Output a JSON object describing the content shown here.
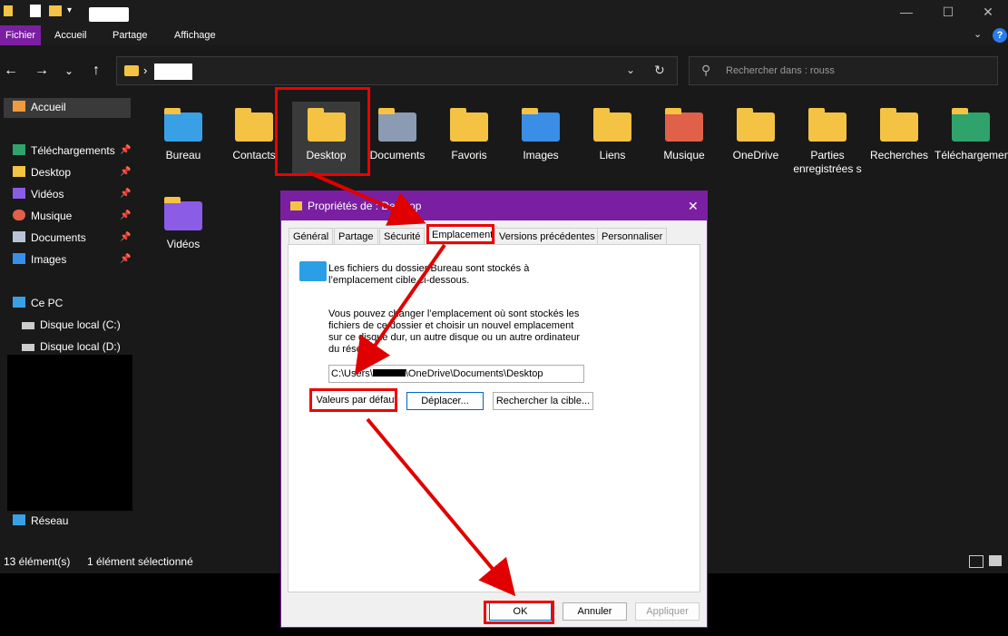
{
  "ribbon": {
    "tabs": [
      "Fichier",
      "Accueil",
      "Partage",
      "Affichage"
    ]
  },
  "search": {
    "placeholder": "Rechercher dans : rouss"
  },
  "sidebar": {
    "items": [
      {
        "label": "Accueil",
        "icon": "home-icon"
      },
      {
        "label": "Téléchargements",
        "icon": "download-icon"
      },
      {
        "label": "Desktop",
        "icon": "folder-icon"
      },
      {
        "label": "Vidéos",
        "icon": "video-icon"
      },
      {
        "label": "Musique",
        "icon": "music-icon"
      },
      {
        "label": "Documents",
        "icon": "documents-icon"
      },
      {
        "label": "Images",
        "icon": "images-icon"
      },
      {
        "label": "Ce PC",
        "icon": "computer-icon"
      },
      {
        "label": "Disque local (C:)",
        "icon": "drive-icon"
      },
      {
        "label": "Disque local (D:)",
        "icon": "drive-icon"
      },
      {
        "label": "Réseau",
        "icon": "network-icon"
      }
    ]
  },
  "folders": [
    {
      "label": "Bureau"
    },
    {
      "label": "Contacts"
    },
    {
      "label": "Desktop"
    },
    {
      "label": "Documents"
    },
    {
      "label": "Favoris"
    },
    {
      "label": "Images"
    },
    {
      "label": "Liens"
    },
    {
      "label": "Musique"
    },
    {
      "label": "OneDrive"
    },
    {
      "label": "Parties enregistrées s"
    },
    {
      "label": "Recherches"
    },
    {
      "label": "Téléchargements"
    },
    {
      "label": "Vidéos"
    }
  ],
  "status": {
    "count": "13 élément(s)",
    "selected": "1 élément sélectionné"
  },
  "dialog": {
    "title": "Propriétés de : Desktop",
    "tabs": [
      "Général",
      "Partage",
      "Sécurité",
      "Emplacement",
      "Versions précédentes",
      "Personnaliser"
    ],
    "intro": "Les fichiers du dossier Bureau sont stockés à l’emplacement cible ci-dessous.",
    "body": "Vous pouvez changer l’emplacement où sont stockés les fichiers de ce dossier et choisir un nouvel emplacement sur ce disque dur, un autre disque ou un autre ordinateur du réseau.",
    "path_prefix": "C:\\Users\\",
    "path_suffix": "\\OneDrive\\Documents\\Desktop",
    "btn_restore": "Valeurs par défaut",
    "btn_move": "Déplacer...",
    "btn_find": "Rechercher la cible...",
    "btn_ok": "OK",
    "btn_cancel": "Annuler",
    "btn_apply": "Appliquer"
  },
  "colors": {
    "accent": "#7b1fa2",
    "highlight": "#e00000"
  }
}
